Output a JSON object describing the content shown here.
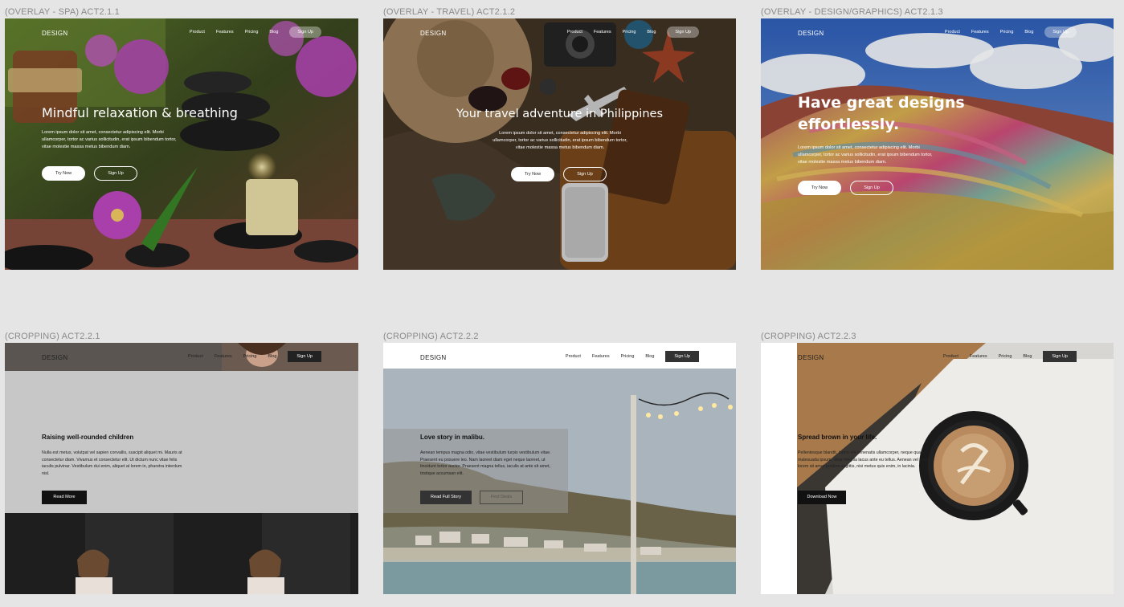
{
  "frames": [
    {
      "label": "(OVERLAY - SPA) ACT2.1.1",
      "brand": "DESIGN",
      "nav": [
        "Product",
        "Features",
        "Pricing",
        "Blog"
      ],
      "signup": "Sign Up",
      "title": "Mindful relaxation & breathing",
      "body": "Lorem ipsum dolor sit amet, consectetur adipiscing elit. Morbi ullamcorper, tortor ac varius sollicitudin, erat ipsum bibendum tortor, vitae molestie massa metus bibendum diam.",
      "primary": "Try Now",
      "secondary": "Sign Up"
    },
    {
      "label": "(OVERLAY - TRAVEL) ACT2.1.2",
      "brand": "DESIGN",
      "nav": [
        "Product",
        "Features",
        "Pricing",
        "Blog"
      ],
      "signup": "Sign Up",
      "title": "Your travel adventure in Philippines",
      "body": "Lorem ipsum dolor sit amet, consectetur adipiscing elit. Morbi ullamcorper, tortor ac varius sollicitudin, erat ipsum bibendum tortor, vitae molestie massa metus bibendum diam.",
      "primary": "Try Now",
      "secondary": "Sign Up"
    },
    {
      "label": "(OVERLAY - DESIGN/GRAPHICS) ACT2.1.3",
      "brand": "DESIGN",
      "nav": [
        "Product",
        "Features",
        "Pricing",
        "Blog"
      ],
      "signup": "Sign Up",
      "title_line1": "Have great designs",
      "title_line2": "effortlessly.",
      "body": "Lorem ipsum dolor sit amet, consectetur adipiscing elit. Morbi ullamcorper, tortor ac varius sollicitudin, erat ipsum bibendum tortor, vitae molestie massa metus bibendum diam.",
      "primary": "Try Now",
      "secondary": "Sign Up"
    },
    {
      "label": "(CROPPING) ACT2.2.1",
      "brand": "DESIGN",
      "nav": [
        "Product",
        "Features",
        "Pricing",
        "Blog"
      ],
      "signup": "Sign Up",
      "title": "Raising well-rounded children",
      "body": "Nulla est metus, volutpat vel sapien convallis, suscipit aliquet mi. Mauris at consectetur diam. Vivamus et consectetur elit. Ut dictum nunc vitae felis iaculis pulvinar. Vestibulum dui enim, aliquet at lorem in, pharetra interdum nisl.",
      "primary": "Read More"
    },
    {
      "label": "(CROPPING) ACT2.2.2",
      "brand": "DESIGN",
      "nav": [
        "Product",
        "Features",
        "Pricing",
        "Blog"
      ],
      "signup": "Sign Up",
      "title": "Love story in malibu.",
      "body": "Aenean tempus magna odio, vitae vestibulum turpis vestibulum vitae. Praesent eu posuere leo. Nam laoreet diam eget neque laoreet, ut tincidunt tortor auctor. Praesent magna tellus, iaculis at ante sit amet, tristique accumsan elit.",
      "primary": "Read Full Story",
      "secondary": "Find Deals"
    },
    {
      "label": "(CROPPING) ACT2.2.3",
      "brand": "DESIGN",
      "nav": [
        "Product",
        "Features",
        "Pricing",
        "Blog"
      ],
      "signup": "Sign Up",
      "title": "Spread brown in your life.",
      "body": "Pellentesque blandit, lorem elit venenatis ullamcorper, neque quam malesuada ipsum, vitae fringilla lacus ante eu tellus. Aenean vel mattis, lorem sit amet pretium sagittis, nisi metus quis enim, in lacinia.",
      "primary": "Download Now"
    }
  ]
}
